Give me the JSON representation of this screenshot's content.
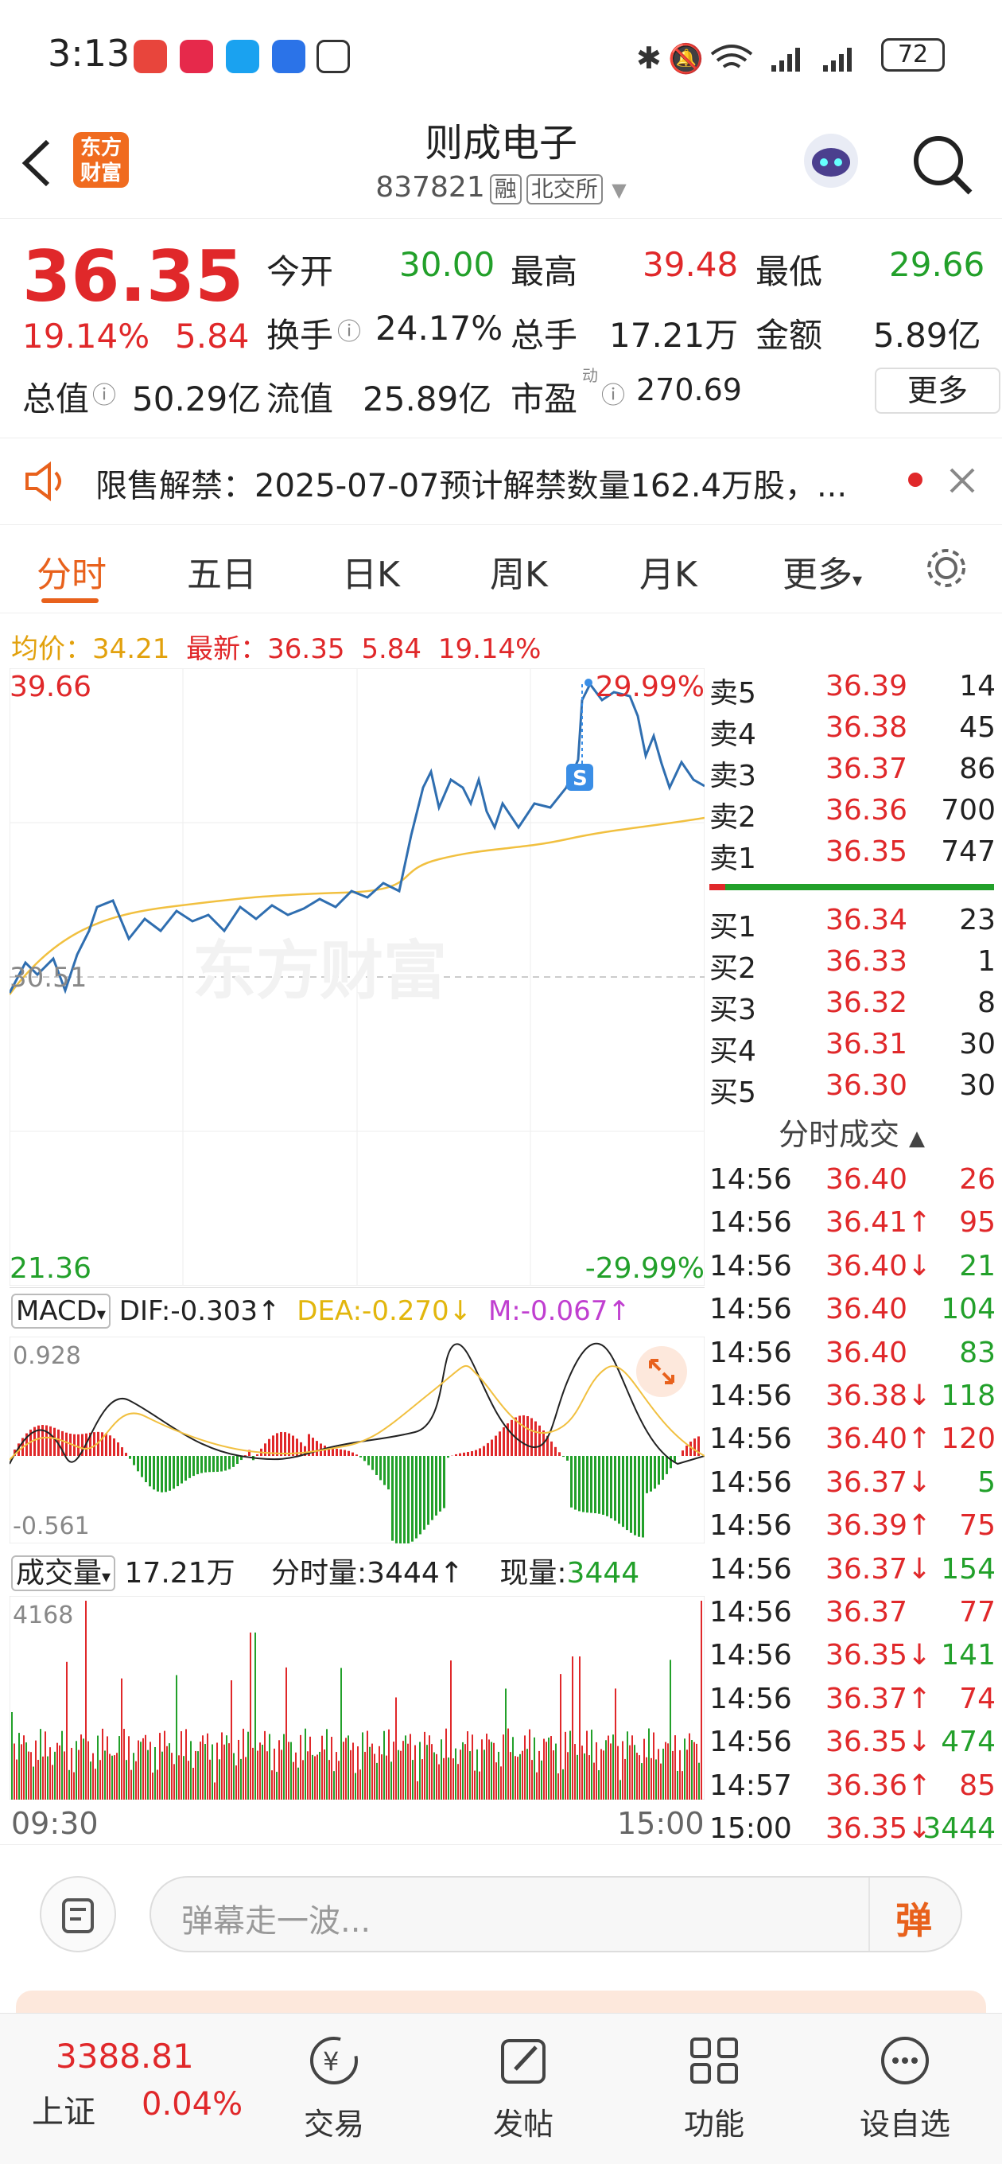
{
  "status_bar": {
    "time": "3:13",
    "battery": "72"
  },
  "header": {
    "title": "则成电子",
    "code": "837821",
    "tag_margin": "融",
    "tag_exchange": "北交所",
    "logo_line1": "东方",
    "logo_line2": "财富"
  },
  "quote": {
    "price": "36.35",
    "change_pct": "19.14%",
    "change": "5.84",
    "open_label": "今开",
    "open": "30.00",
    "high_label": "最高",
    "high": "39.48",
    "low_label": "最低",
    "low": "29.66",
    "turnover_label": "换手",
    "turnover": "24.17%",
    "volume_label": "总手",
    "volume": "17.21万",
    "amount_label": "金额",
    "amount": "5.89亿",
    "mktcap_label": "总值",
    "mktcap": "50.29亿",
    "float_label": "流值",
    "float": "25.89亿",
    "pe_label": "市盈",
    "pe_sup": "动",
    "pe": "270.69",
    "more": "更多"
  },
  "notice": {
    "label": "限售解禁：",
    "text": "2025-07-07预计解禁数量162.4万股，..."
  },
  "tabs": [
    "分时",
    "五日",
    "日K",
    "周K",
    "月K",
    "更多"
  ],
  "chart": {
    "avg_label": "均价：",
    "avg": "34.21",
    "latest_label": "最新：",
    "latest": "36.35",
    "latest_chg": "5.84",
    "latest_pct": "19.14%",
    "y_top": "39.66",
    "y_top_pct": "29.99%",
    "y_mid": "30.51",
    "y_bottom": "21.36",
    "y_bottom_pct": "-29.99%",
    "watermark": "东方财富",
    "macd_label": "MACD",
    "dif": "DIF:-0.303↑",
    "dea": "DEA:-0.270↓",
    "m": "M:-0.067↑",
    "macd_max": "0.928",
    "macd_min": "-0.561",
    "vol_label": "成交量",
    "vol_total": "17.21万",
    "vol_min_label": "分时量:",
    "vol_min": "3444↑",
    "vol_now_label": "现量:",
    "vol_now": "3444",
    "vol_max": "4168",
    "time_start": "09:30",
    "time_end": "15:00"
  },
  "orderbook": {
    "asks": [
      {
        "label": "卖5",
        "price": "36.39",
        "vol": "14"
      },
      {
        "label": "卖4",
        "price": "36.38",
        "vol": "45"
      },
      {
        "label": "卖3",
        "price": "36.37",
        "vol": "86"
      },
      {
        "label": "卖2",
        "price": "36.36",
        "vol": "700"
      },
      {
        "label": "卖1",
        "price": "36.35",
        "vol": "747"
      }
    ],
    "bids": [
      {
        "label": "买1",
        "price": "36.34",
        "vol": "23"
      },
      {
        "label": "买2",
        "price": "36.33",
        "vol": "1"
      },
      {
        "label": "买3",
        "price": "36.32",
        "vol": "8"
      },
      {
        "label": "买4",
        "price": "36.31",
        "vol": "30"
      },
      {
        "label": "买5",
        "price": "36.30",
        "vol": "30"
      }
    ]
  },
  "trades_title": "分时成交",
  "trades": [
    {
      "time": "14:56",
      "price": "36.40",
      "vol": "26",
      "vc": "red"
    },
    {
      "time": "14:56",
      "price": "36.41↑",
      "vol": "95",
      "vc": "red"
    },
    {
      "time": "14:56",
      "price": "36.40↓",
      "vol": "21",
      "vc": "green"
    },
    {
      "time": "14:56",
      "price": "36.40",
      "vol": "104",
      "vc": "green"
    },
    {
      "time": "14:56",
      "price": "36.40",
      "vol": "83",
      "vc": "green"
    },
    {
      "time": "14:56",
      "price": "36.38↓",
      "vol": "118",
      "vc": "green"
    },
    {
      "time": "14:56",
      "price": "36.40↑",
      "vol": "120",
      "vc": "red"
    },
    {
      "time": "14:56",
      "price": "36.37↓",
      "vol": "5",
      "vc": "green"
    },
    {
      "time": "14:56",
      "price": "36.39↑",
      "vol": "75",
      "vc": "red"
    },
    {
      "time": "14:56",
      "price": "36.37↓",
      "vol": "154",
      "vc": "green"
    },
    {
      "time": "14:56",
      "price": "36.37",
      "vol": "77",
      "vc": "red"
    },
    {
      "time": "14:56",
      "price": "36.35↓",
      "vol": "141",
      "vc": "green"
    },
    {
      "time": "14:56",
      "price": "36.37↑",
      "vol": "74",
      "vc": "red"
    },
    {
      "time": "14:56",
      "price": "36.35↓",
      "vol": "474",
      "vc": "green"
    },
    {
      "time": "14:57",
      "price": "36.36↑",
      "vol": "85",
      "vc": "red"
    },
    {
      "time": "15:00",
      "price": "36.35↓",
      "vol": "3444",
      "vc": "green"
    }
  ],
  "input": {
    "placeholder": "弹幕走一波...",
    "danmu": "弹"
  },
  "footer": {
    "index_value": "3388.81",
    "index_name": "上证",
    "index_pct": "0.04%",
    "trade": "交易",
    "post": "发帖",
    "func": "功能",
    "watch": "设自选"
  }
}
